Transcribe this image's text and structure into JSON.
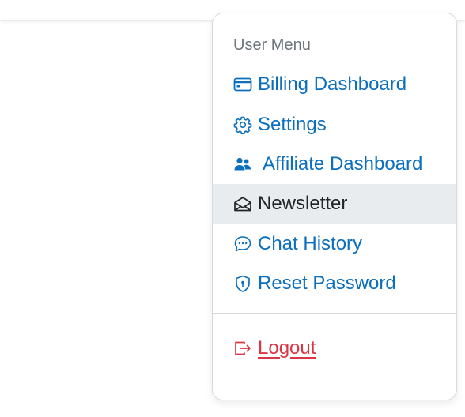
{
  "menu": {
    "header": "User Menu",
    "items": [
      {
        "label": "Billing Dashboard",
        "icon": "credit-card-icon"
      },
      {
        "label": "Settings",
        "icon": "gear-icon"
      },
      {
        "label": "Affiliate Dashboard",
        "icon": "people-icon"
      },
      {
        "label": "Newsletter",
        "icon": "envelope-open-icon",
        "active": true
      },
      {
        "label": "Chat History",
        "icon": "chat-dots-icon"
      },
      {
        "label": "Reset Password",
        "icon": "shield-lock-icon"
      }
    ],
    "logout": {
      "label": "Logout",
      "icon": "box-arrow-right-icon"
    }
  },
  "colors": {
    "link": "#0b6fbd",
    "active_text": "#212529",
    "active_bg": "#e9ecef",
    "header": "#6c757d",
    "logout": "#dc3545"
  }
}
